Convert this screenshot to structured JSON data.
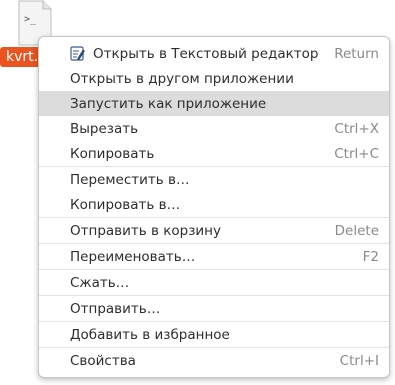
{
  "desktop_file": {
    "name": "kvrt.",
    "icon": "terminal-script-file-icon",
    "icon_glyph": ">_"
  },
  "menu": {
    "items": [
      {
        "label": "Открыть в Текстовый редактор",
        "accel": "Return",
        "icon": "text-editor-icon"
      },
      {
        "label": "Открыть в другом приложении",
        "accel": ""
      },
      {
        "label": "Запустить как приложение",
        "accel": "",
        "highlighted": true
      },
      {
        "label": "Вырезать",
        "accel": "Ctrl+X"
      },
      {
        "label": "Копировать",
        "accel": "Ctrl+C"
      },
      {
        "label": "Переместить в…",
        "accel": ""
      },
      {
        "label": "Копировать в…",
        "accel": ""
      },
      {
        "label": "Отправить в корзину",
        "accel": "Delete"
      },
      {
        "label": "Переименовать…",
        "accel": "F2"
      },
      {
        "label": "Сжать…",
        "accel": ""
      },
      {
        "label": "Отправить…",
        "accel": ""
      },
      {
        "label": "Добавить в избранное",
        "accel": ""
      },
      {
        "label": "Свойства",
        "accel": "Ctrl+I"
      }
    ]
  },
  "colors": {
    "label_bg": "#e95420",
    "highlight_bg": "#dcdcdc",
    "accel_text": "#8a8a8a"
  }
}
